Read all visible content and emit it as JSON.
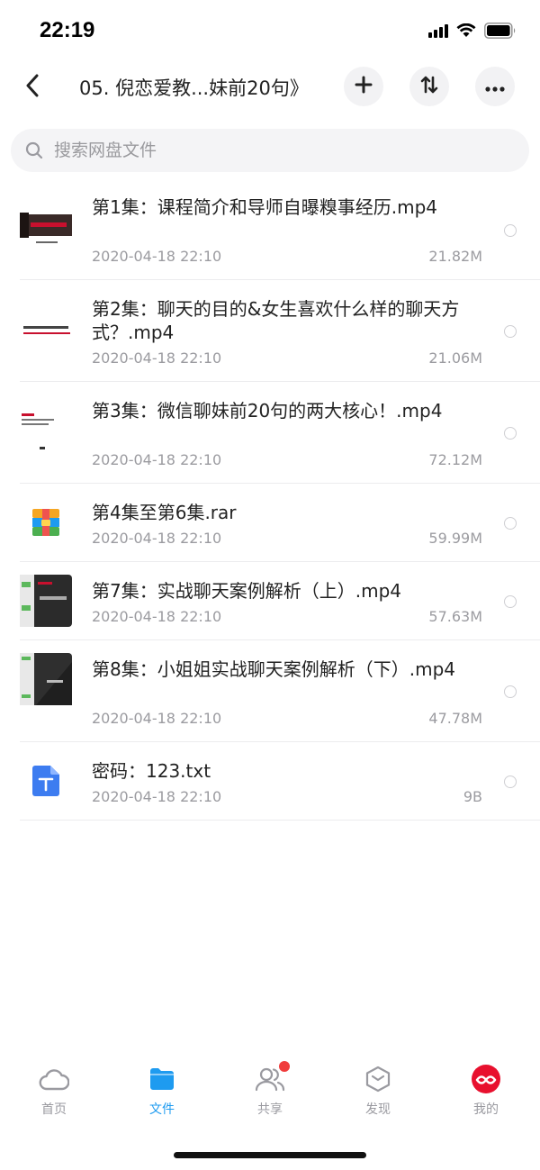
{
  "status_bar": {
    "time": "22:19"
  },
  "nav": {
    "title": "05. 倪恋爱教...妹前20句》"
  },
  "search": {
    "placeholder": "搜索网盘文件"
  },
  "files": [
    {
      "name": "第1集：课程简介和导师自曝糗事经历.mp4",
      "date": "2020-04-18 22:10",
      "size": "21.82M",
      "thumb": "video-thumbnail"
    },
    {
      "name": "第2集：聊天的目的&女生喜欢什么样的聊天方式？.mp4",
      "date": "2020-04-18 22:10",
      "size": "21.06M",
      "thumb": "video-thumbnail"
    },
    {
      "name": "第3集：微信聊妹前20句的两大核心！.mp4",
      "date": "2020-04-18 22:10",
      "size": "72.12M",
      "thumb": "video-thumbnail"
    },
    {
      "name": "第4集至第6集.rar",
      "date": "2020-04-18 22:10",
      "size": "59.99M",
      "thumb": "rar-archive-icon"
    },
    {
      "name": "第7集：实战聊天案例解析（上）.mp4",
      "date": "2020-04-18 22:10",
      "size": "57.63M",
      "thumb": "video-thumbnail"
    },
    {
      "name": "第8集：小姐姐实战聊天案例解析（下）.mp4",
      "date": "2020-04-18 22:10",
      "size": "47.78M",
      "thumb": "video-thumbnail"
    },
    {
      "name": "密码：123.txt",
      "date": "2020-04-18 22:10",
      "size": "9B",
      "thumb": "text-file-icon"
    }
  ],
  "tabs": [
    {
      "label": "首页",
      "icon": "cloud-icon"
    },
    {
      "label": "文件",
      "icon": "folder-icon",
      "active": true
    },
    {
      "label": "共享",
      "icon": "users-icon",
      "badge": true
    },
    {
      "label": "发现",
      "icon": "cube-icon"
    },
    {
      "label": "我的",
      "icon": "avatar-icon"
    }
  ],
  "colors": {
    "accent": "#1e9bf0",
    "badge": "#f03c3c",
    "muted": "#9a9aa0"
  }
}
